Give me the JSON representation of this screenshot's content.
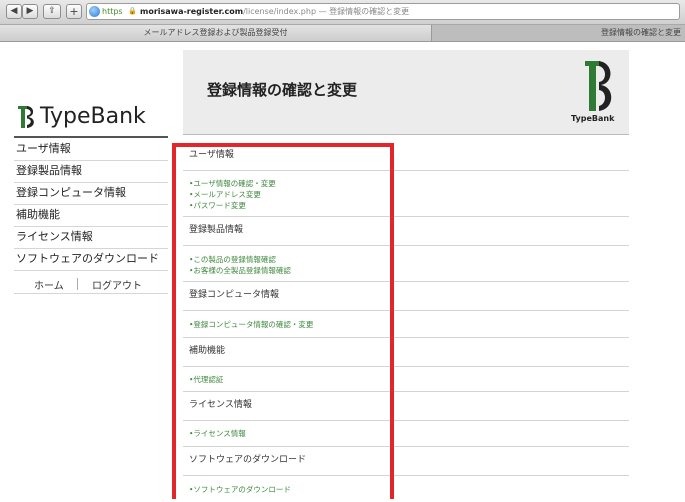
{
  "browser": {
    "nav": {
      "back_icon": "◀",
      "forward_icon": "▶",
      "share_icon": "⇪",
      "add_icon": "+"
    },
    "address": {
      "protocol": "https",
      "host": "morisawa-register.com",
      "path_title": "/license/index.php — 登録情報の確認と変更"
    },
    "tabs": [
      {
        "label": "メールアドレス登録および製品登録受付"
      },
      {
        "label": "登録情報の確認と変更"
      }
    ]
  },
  "sidebar": {
    "logo_text": "TypeBank",
    "items": [
      {
        "label": "ユーザ情報"
      },
      {
        "label": "登録製品情報"
      },
      {
        "label": "登録コンピュータ情報"
      },
      {
        "label": "補助機能"
      },
      {
        "label": "ライセンス情報"
      },
      {
        "label": "ソフトウェアのダウンロード"
      }
    ],
    "home_label": "ホーム",
    "logout_label": "ログアウト"
  },
  "header": {
    "title": "登録情報の確認と変更",
    "brand": "TypeBank"
  },
  "sections": [
    {
      "heading": "ユーザ情報",
      "links": [
        "•ユーザ情報の確認・変更",
        "•メールアドレス変更",
        "•パスワード変更"
      ]
    },
    {
      "heading": "登録製品情報",
      "links": [
        "•この製品の登録情報確認",
        "•お客様の全製品登録情報確認"
      ]
    },
    {
      "heading": "登録コンピュータ情報",
      "links": [
        "•登録コンピュータ情報の確認・変更"
      ]
    },
    {
      "heading": "補助機能",
      "links": [
        "•代理認証"
      ]
    },
    {
      "heading": "ライセンス情報",
      "links": [
        "•ライセンス情報"
      ]
    },
    {
      "heading": "ソフトウェアのダウンロード",
      "links": [
        "•ソフトウェアのダウンロード"
      ]
    }
  ],
  "colors": {
    "highlight": "#e3262b",
    "link": "#3f8a3f",
    "header_bg": "#ececec"
  }
}
